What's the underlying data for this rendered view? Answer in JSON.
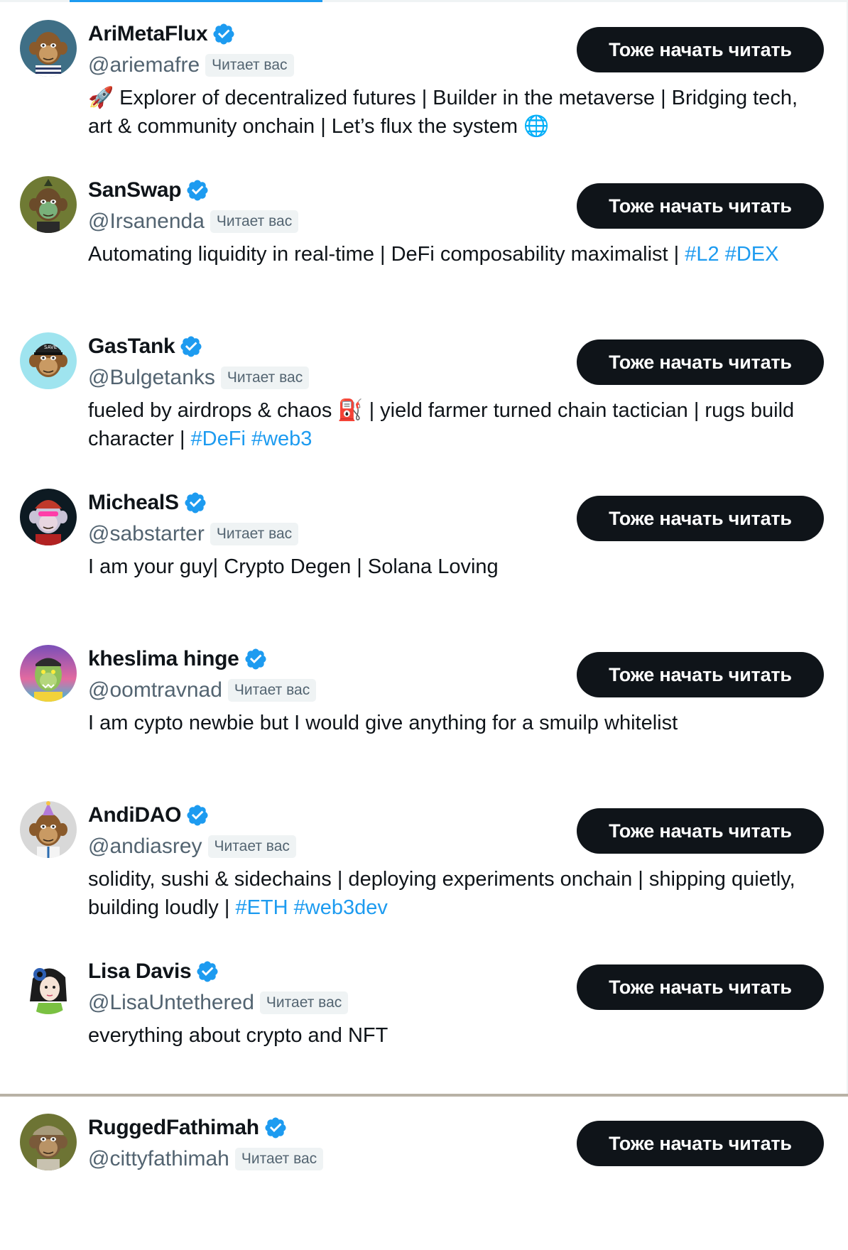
{
  "follow_label": "Тоже начать читать",
  "follows_you_label": "Читает вас",
  "colors": {
    "accent": "#1d9bf0",
    "button_bg": "#0f1419",
    "muted": "#536471",
    "badge_bg": "#eff3f4"
  },
  "users": [
    {
      "name": "AriMetaFlux",
      "handle": "@ariemafre",
      "bio_parts": [
        {
          "text": "🚀 Explorer of decentralized futures | Builder in the metaverse | Bridging tech, art & community onchain | Let’s flux the system 🌐",
          "tag": false
        }
      ],
      "avatar_icon": "ape-avatar-striped-shirt"
    },
    {
      "name": "SanSwap",
      "handle": "@Irsanenda",
      "bio_parts": [
        {
          "text": "Automating liquidity in real-time | DeFi composability maximalist | ",
          "tag": false
        },
        {
          "text": "#L2",
          "tag": true
        },
        {
          "text": " ",
          "tag": false
        },
        {
          "text": "#DEX",
          "tag": true
        }
      ],
      "avatar_icon": "ape-avatar-mohawk"
    },
    {
      "name": "GasTank",
      "handle": "@Bulgetanks",
      "bio_parts": [
        {
          "text": "fueled by airdrops & chaos ⛽ | yield farmer turned chain tactician | rugs build character | ",
          "tag": false
        },
        {
          "text": "#DeFi",
          "tag": true
        },
        {
          "text": " ",
          "tag": false
        },
        {
          "text": "#web3",
          "tag": true
        }
      ],
      "avatar_icon": "ape-avatar-cap"
    },
    {
      "name": "MichealS",
      "handle": "@sabstarter",
      "bio_parts": [
        {
          "text": "I am your guy| Crypto Degen | Solana Loving",
          "tag": false
        }
      ],
      "avatar_icon": "ape-avatar-beanie"
    },
    {
      "name": "kheslima hinge",
      "handle": "@oomtravnad",
      "bio_parts": [
        {
          "text": "I am cypto newbie but I would give anything for a smuilp whitelist",
          "tag": false
        }
      ],
      "avatar_icon": "ape-avatar-zombie"
    },
    {
      "name": "AndiDAO",
      "handle": "@andiasrey",
      "bio_parts": [
        {
          "text": "solidity, sushi & sidechains | deploying experiments onchain | shipping quietly, building loudly | ",
          "tag": false
        },
        {
          "text": "#ETH",
          "tag": true
        },
        {
          "text": " ",
          "tag": false
        },
        {
          "text": "#web3dev",
          "tag": true
        }
      ],
      "avatar_icon": "ape-avatar-party-hat"
    },
    {
      "name": "Lisa Davis",
      "handle": "@LisaUntethered",
      "bio_parts": [
        {
          "text": "everything about crypto and NFT",
          "tag": false
        }
      ],
      "avatar_icon": "anime-girl-avatar"
    },
    {
      "name": "RuggedFathimah",
      "handle": "@cittyfathimah",
      "bio_parts": [],
      "avatar_icon": "ape-avatar-hat"
    }
  ]
}
